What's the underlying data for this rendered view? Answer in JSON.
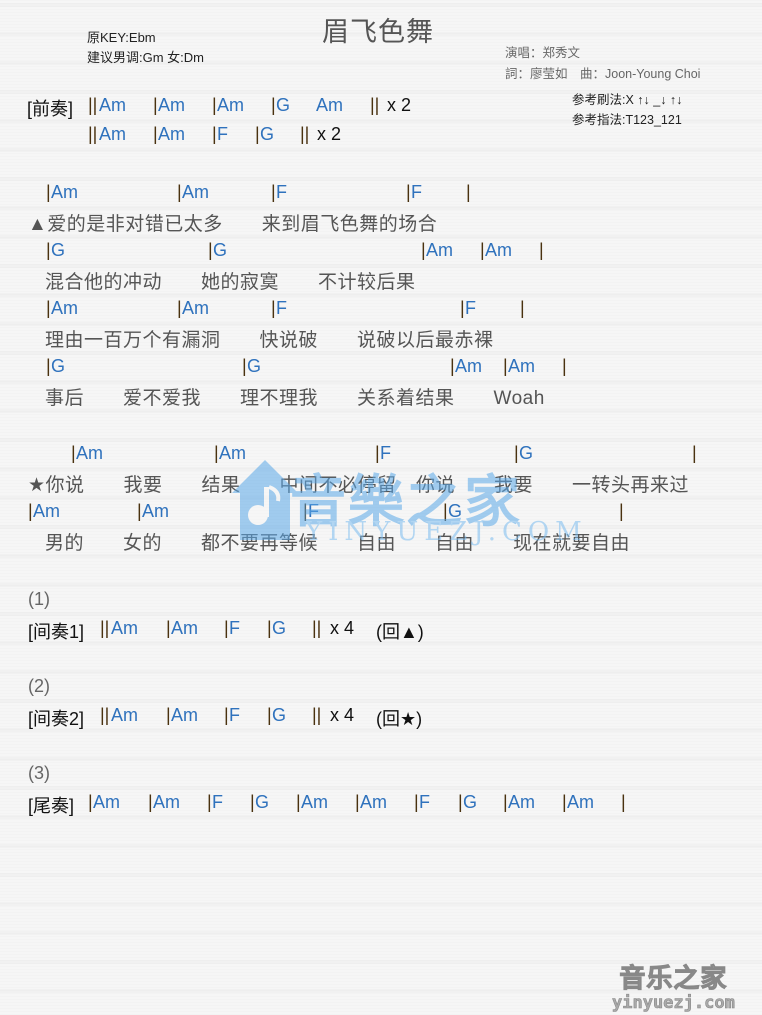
{
  "header": {
    "title": "眉飞色舞",
    "original_key": "原KEY:Ebm",
    "suggested_key": "建议男调:Gm 女:Dm",
    "singer": "演唱：郑秀文",
    "credits": "詞：廖莹如　曲：Joon-Young Choi",
    "strum_pattern": "参考刷法:X ↑↓ _↓ ↑↓",
    "finger_pattern": "参考指法:T123_121"
  },
  "intro": {
    "label": "[前奏]",
    "line1": {
      "open": "||",
      "chords": [
        "Am",
        "Am",
        "Am",
        "G",
        "Am"
      ],
      "close": "||",
      "repeat": "x 2"
    },
    "line2": {
      "open": "||",
      "chords": [
        "Am",
        "Am",
        "F",
        "G"
      ],
      "close": "||",
      "repeat": "x 2"
    }
  },
  "verse": [
    {
      "chords": [
        "Am",
        "Am",
        "F",
        "F"
      ],
      "lyric": "▲爱的是非对错已太多　　来到眉飞色舞的场合"
    },
    {
      "chords": [
        "G",
        "G",
        "Am",
        "Am"
      ],
      "lyric": "混合他的冲动　　她的寂寞　　不计较后果"
    },
    {
      "chords": [
        "Am",
        "Am",
        "F",
        "F"
      ],
      "lyric": "理由一百万个有漏洞　　快说破　　说破以后最赤裸"
    },
    {
      "chords": [
        "G",
        "G",
        "Am",
        "Am"
      ],
      "lyric": "事后　　爱不爱我　　理不理我　　关系着结果　　Woah"
    }
  ],
  "chorus": [
    {
      "chords": [
        "Am",
        "Am",
        "F",
        "G"
      ],
      "lyric": "★你说　　我要　　结果　　中间不必停留　你说　　我要　　一转头再来过"
    },
    {
      "chords": [
        "Am",
        "Am",
        "F",
        "G"
      ],
      "lyric": "男的　　女的　　都不要再等候　　自由　　自由　　现在就要自由"
    }
  ],
  "interludes": [
    {
      "number": "(1)",
      "label": "[间奏1]",
      "open": "||",
      "chords": [
        "Am",
        "Am",
        "F",
        "G"
      ],
      "close": "||",
      "repeat": "x 4",
      "return": "(回▲)"
    },
    {
      "number": "(2)",
      "label": "[间奏2]",
      "open": "||",
      "chords": [
        "Am",
        "Am",
        "F",
        "G"
      ],
      "close": "||",
      "repeat": "x 4",
      "return": "(回★)"
    }
  ],
  "outro": {
    "number": "(3)",
    "label": "[尾奏]",
    "chords": [
      "Am",
      "Am",
      "F",
      "G",
      "Am",
      "Am",
      "F",
      "G",
      "Am",
      "Am"
    ]
  },
  "watermark": {
    "text": "音樂之家",
    "url": "YINYUEZJ.COM"
  },
  "corner_logo": {
    "text": "音乐之家",
    "url": "yinyuezj.com"
  },
  "colors": {
    "chord": "#2f72bd",
    "bar": "#4a3210",
    "lyric": "#555555",
    "label": "#111111"
  }
}
